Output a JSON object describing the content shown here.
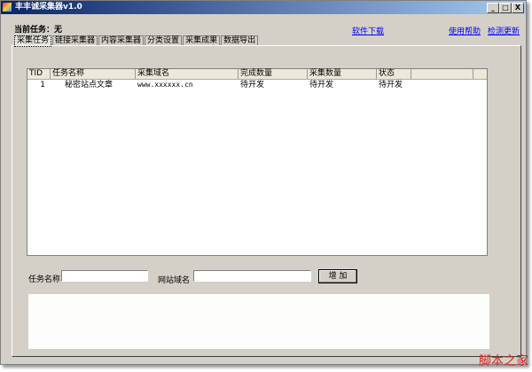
{
  "window": {
    "title": "丰丰诚采集器v1.0",
    "min": "_",
    "max": "□",
    "close": "X"
  },
  "current_task": "当前任务：无",
  "links": {
    "download": "软件下载",
    "help": "使用帮助",
    "update": "检测更新"
  },
  "tabs": [
    "采集任务",
    "链接采集器",
    "内容采集器",
    "分类设置",
    "采集成果",
    "数据导出"
  ],
  "table": {
    "columns": [
      "TID",
      "任务名称",
      "采集域名",
      "完成数量",
      "采集数量",
      "状态"
    ],
    "rows": [
      [
        "1",
        "秘密站点文章",
        "www.xxxxxx.cn",
        "待开发",
        "待开发",
        "待开发"
      ]
    ]
  },
  "form": {
    "task_name_label": "任务名称",
    "task_name_value": "",
    "domain_label": "网站域名",
    "domain_value": "",
    "add_button": "增 加"
  },
  "watermark": "脚本之家"
}
